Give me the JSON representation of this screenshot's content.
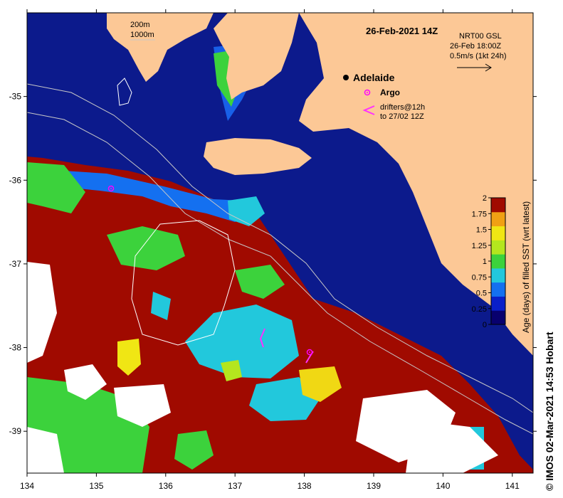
{
  "title": "26-Feb-2021 14Z",
  "depth_labels": [
    "200m",
    "1000m"
  ],
  "current_info": [
    "NRT00 GSL",
    "26-Feb 18:00Z",
    "0.5m/s (1kt 24h)"
  ],
  "place": {
    "name": "Adelaide",
    "lon": 138.6,
    "lat": -34.93
  },
  "argo_label": "Argo",
  "argo_floats": [
    {
      "lon": 135.2,
      "lat": -36.2
    },
    {
      "lon": 138.05,
      "lat": -38.1
    }
  ],
  "drifter_label_lines": [
    "drifters@12h",
    "to 27/02 12Z"
  ],
  "x_ticks": [
    "134",
    "135",
    "136",
    "137",
    "138",
    "139",
    "140",
    "141"
  ],
  "y_ticks": [
    "-35",
    "-36",
    "-37",
    "-38",
    "-39"
  ],
  "map_extent": {
    "lon_min": 134,
    "lon_max": 141.3,
    "lat_min": -39.5,
    "lat_max": -34.0
  },
  "colorbar": {
    "title": "Age (days) of filled SST (wrt latest)",
    "ticks": [
      "2",
      "1.75",
      "1.5",
      "1.25",
      "1",
      "0.75",
      "0.5",
      "0.25",
      "0"
    ],
    "min": 0,
    "max": 2,
    "colors": [
      "#08006e",
      "#0a1fc8",
      "#1470f0",
      "#22c8dc",
      "#3cd23c",
      "#b4e61e",
      "#f0e614",
      "#f0a014",
      "#a00a00"
    ]
  },
  "colors": {
    "land": "#fcc896",
    "ocean_fresh": "#0c1a8c",
    "ocean_old": "#a00a00",
    "no_data": "#ffffff"
  },
  "credit": "© IMOS 02-Mar-2021 14:53 Hobart"
}
